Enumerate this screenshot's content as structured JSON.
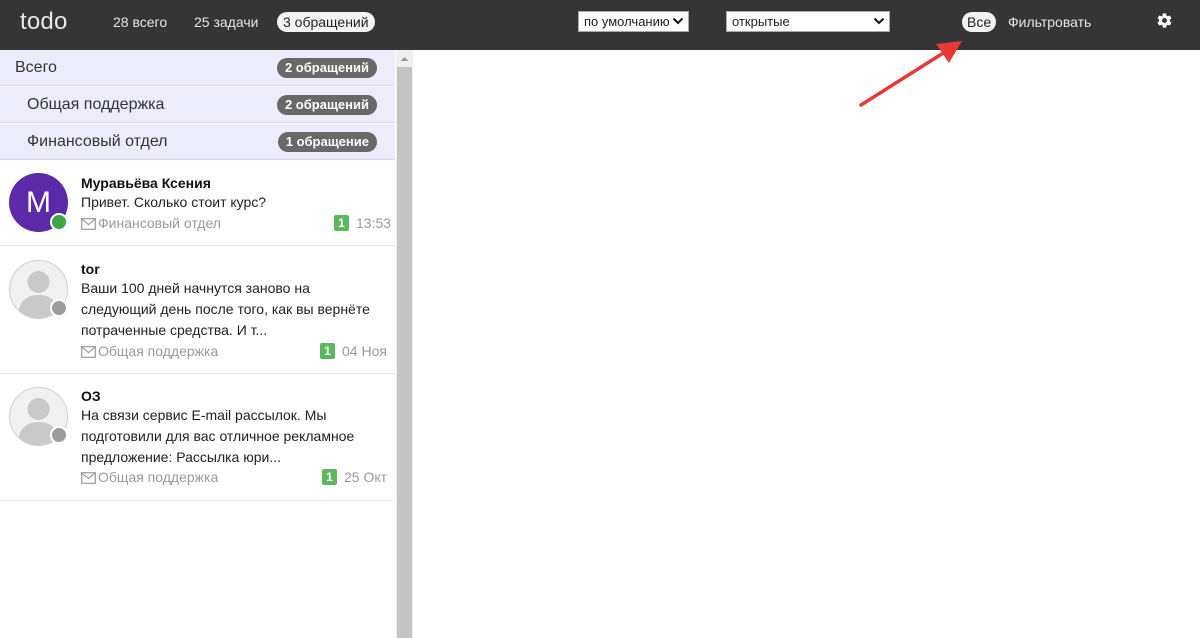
{
  "app": {
    "logo": "todo"
  },
  "topbar": {
    "counters": [
      {
        "label": "28 всего"
      },
      {
        "label": "25 задачи"
      },
      {
        "label": "3 обращений",
        "active": true
      }
    ],
    "sort_select": {
      "value": "по умолчанию"
    },
    "state_select": {
      "value": "открытые"
    },
    "all_pill": "Все",
    "filter_label": "Фильтровать",
    "settings_icon": "gear-icon"
  },
  "categories": [
    {
      "label": "Всего",
      "badge": "2 обращений"
    },
    {
      "label": "Общая поддержка",
      "badge": "2 обращений"
    },
    {
      "label": "Финансовый отдел",
      "badge": "1 обращение"
    }
  ],
  "conversations": [
    {
      "avatar_letter": "M",
      "avatar_color": "#5a2aa8",
      "status": "online",
      "name": "Муравьёва Ксения",
      "message": "Привет. Сколько стоит курс?",
      "channel_icon": "envelope-icon",
      "channel": "Финансовый отдел",
      "count": "1",
      "time": "13:53"
    },
    {
      "avatar_letter": "",
      "status": "offline",
      "name": "tor",
      "message": "Ваши 100 дней начнутся заново на следующий день после того, как вы вернёте потраченные средства. И т...",
      "channel_icon": "envelope-icon",
      "channel": "Общая поддержка",
      "count": "1",
      "time": "04 Ноя"
    },
    {
      "avatar_letter": "",
      "status": "offline",
      "name": "ОЗ",
      "message": "На связи сервис E-mail рассылок. Мы подготовили для вас отличное рекламное предложение: Рассылка юри...",
      "channel_icon": "envelope-icon",
      "channel": "Общая поддержка",
      "count": "1",
      "time": "25 Окт"
    }
  ],
  "colors": {
    "topbar": "#353535",
    "category_bg": "#edecfb",
    "badge": "#686868",
    "count_badge": "#5cb85c",
    "online": "#39a845",
    "offline": "#9c9c9c",
    "annotation_arrow": "#e53a35"
  }
}
